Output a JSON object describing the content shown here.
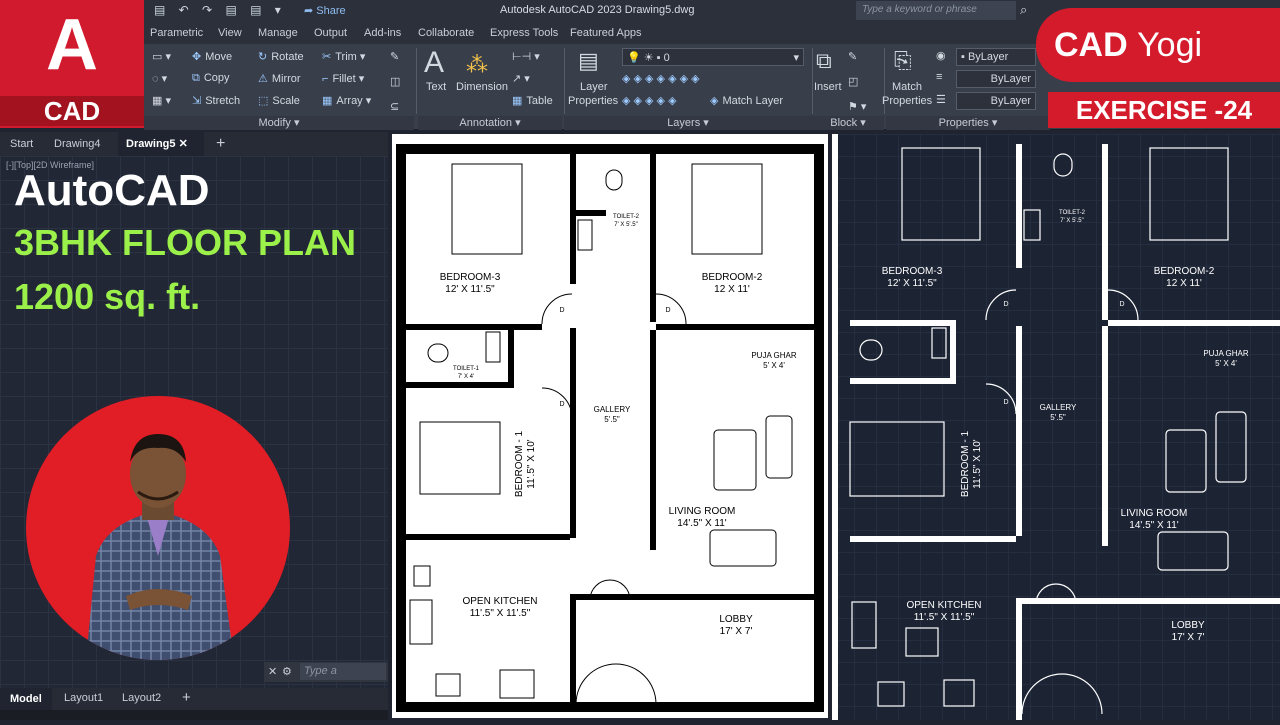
{
  "app_logo": {
    "letter": "A",
    "label": "CAD"
  },
  "titlebar": {
    "share": "Share",
    "title": "Autodesk AutoCAD 2023    Drawing5.dwg",
    "search_placeholder": "Type a keyword or phrase"
  },
  "ribbon_tabs": [
    "Parametric",
    "View",
    "Manage",
    "Output",
    "Add-ins",
    "Collaborate",
    "Express Tools",
    "Featured Apps"
  ],
  "ribbon": {
    "modify": {
      "move": "Move",
      "rotate": "Rotate",
      "trim": "Trim",
      "copy": "Copy",
      "mirror": "Mirror",
      "fillet": "Fillet",
      "stretch": "Stretch",
      "scale": "Scale",
      "array": "Array",
      "title": "Modify"
    },
    "annotation": {
      "text": "Text",
      "dimension": "Dimension",
      "table": "Table",
      "title": "Annotation"
    },
    "layers": {
      "layer_properties_1": "Layer",
      "layer_properties_2": "Properties",
      "layer_value": "0",
      "match_layer": "Match Layer",
      "title": "Layers"
    },
    "block": {
      "insert": "Insert",
      "title": "Block"
    },
    "properties": {
      "match_1": "Match",
      "match_2": "Properties",
      "bylayer1": "ByLayer",
      "bylayer2": "ByLayer",
      "bylayer3": "ByLayer",
      "title": "Properties"
    }
  },
  "brand": {
    "cad": "CAD",
    "yogi": "Yogi",
    "exercise": "EXERCISE -24"
  },
  "doc_tabs": {
    "start": "Start",
    "drawing4": "Drawing4",
    "drawing5": "Drawing5",
    "add": "+"
  },
  "viewport_label": "[-][Top][2D Wireframe]",
  "headline": {
    "line1": "AutoCAD",
    "line2": "3BHK FLOOR PLAN",
    "line3": "1200 sq. ft."
  },
  "command_placeholder": "Type a",
  "layout_tabs": {
    "model": "Model",
    "layout1": "Layout1",
    "layout2": "Layout2",
    "add": "+"
  },
  "plan": {
    "bedroom3": "BEDROOM-3",
    "bedroom3_size": "12' X 11'.5\"",
    "bedroom2": "BEDROOM-2",
    "bedroom2_size": "12 X 11'",
    "toilet2": "TOILET-2",
    "toilet2_size": "7' X 5'.5\"",
    "toilet1": "TOILET-1",
    "toilet1_size": "7' X 4'",
    "puja": "PUJA GHAR",
    "puja_size": "5' X 4'",
    "gallery": "GALLERY",
    "gallery_size": "5'.5\"",
    "bedroom1": "BEDROOM - 1",
    "bedroom1_size": "11'.5\" X 10'",
    "living": "LIVING ROOM",
    "living_size": "14'.5\" X 11'",
    "kitchen": "OPEN KITCHEN",
    "kitchen_size": "11'.5\" X 11'.5\"",
    "lobby": "LOBBY",
    "lobby_size": "17' X 7'",
    "door": "D"
  },
  "colors": {
    "brand_red": "#d41b2c",
    "headline_green": "#9bf04a",
    "plan_dark": "#1c2333"
  }
}
